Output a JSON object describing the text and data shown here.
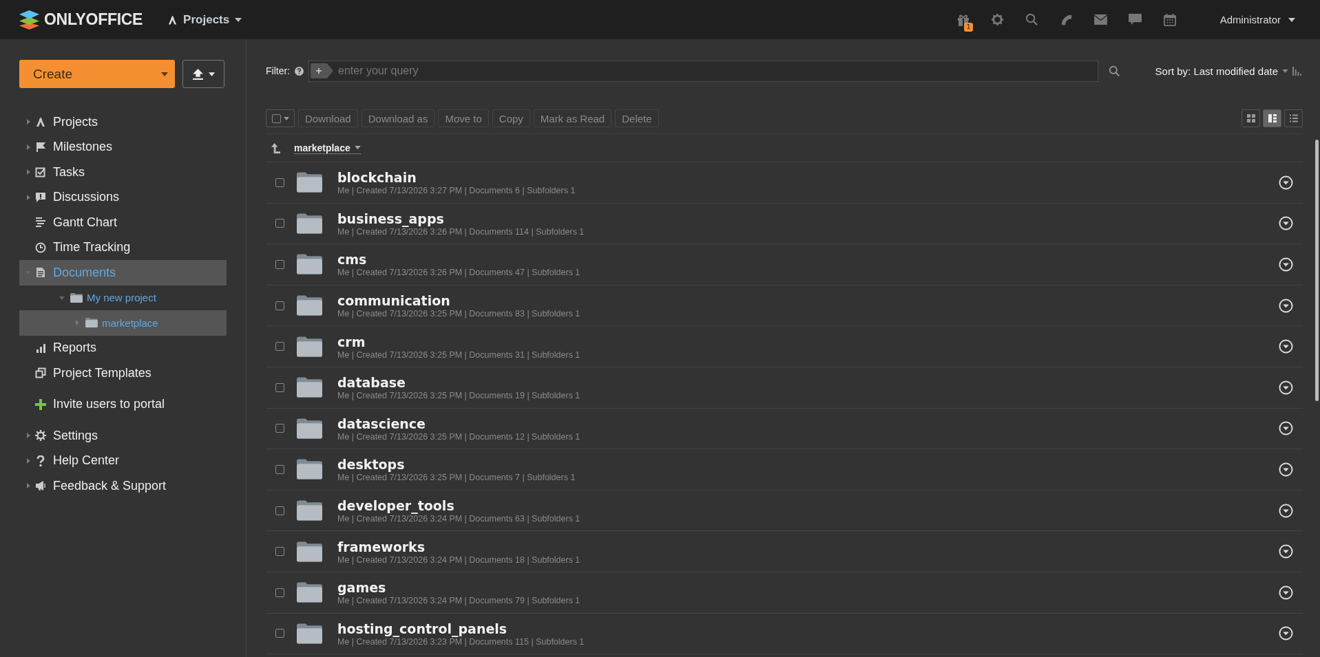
{
  "header": {
    "logo": "ONLYOFFICE",
    "module": "Projects",
    "gift_badge": "1",
    "user": "Administrator"
  },
  "sidebar": {
    "create_button": "Create",
    "nav": [
      {
        "label": "Projects",
        "expanded": false,
        "selected": false
      },
      {
        "label": "Milestones",
        "expanded": false,
        "selected": false
      },
      {
        "label": "Tasks",
        "expanded": false,
        "selected": false
      },
      {
        "label": "Discussions",
        "expanded": false,
        "selected": false
      },
      {
        "label": "Gantt Chart",
        "selected": false
      },
      {
        "label": "Time Tracking",
        "selected": false
      },
      {
        "label": "Documents",
        "expanded": true,
        "selected": true,
        "children": [
          {
            "label": "My new project",
            "expanded": true,
            "selected": false,
            "children": [
              {
                "label": "marketplace",
                "expanded": false,
                "selected": true
              }
            ]
          }
        ]
      },
      {
        "label": "Reports",
        "selected": false
      },
      {
        "label": "Project Templates",
        "selected": false
      }
    ],
    "invite": "Invite users to portal",
    "footer": [
      {
        "label": "Settings",
        "expanded": false
      },
      {
        "label": "Help Center",
        "expanded": false
      },
      {
        "label": "Feedback & Support",
        "expanded": false
      }
    ]
  },
  "filter": {
    "label": "Filter:",
    "placeholder": "enter your query",
    "sort": "Sort by: Last modified date"
  },
  "toolbar": {
    "actions": [
      {
        "label": "Download",
        "disabled": true
      },
      {
        "label": "Download as",
        "disabled": true
      },
      {
        "label": "Move to",
        "disabled": true
      },
      {
        "label": "Copy",
        "disabled": true
      },
      {
        "label": "Mark as Read",
        "disabled": true
      },
      {
        "label": "Delete",
        "disabled": true
      }
    ],
    "views": [
      {
        "selected": false
      },
      {
        "selected": true
      },
      {
        "selected": false
      }
    ]
  },
  "breadcrumb": "marketplace",
  "folders": [
    {
      "name": "blockchain",
      "meta": "Me | Created 7/13/2026 3:27 PM | Documents 6 | Subfolders 1",
      "checked": false
    },
    {
      "name": "business_apps",
      "meta": "Me | Created 7/13/2026 3:26 PM | Documents 114 | Subfolders 1",
      "checked": false
    },
    {
      "name": "cms",
      "meta": "Me | Created 7/13/2026 3:26 PM | Documents 47 | Subfolders 1",
      "checked": false
    },
    {
      "name": "communication",
      "meta": "Me | Created 7/13/2026 3:25 PM | Documents 83 | Subfolders 1",
      "checked": false
    },
    {
      "name": "crm",
      "meta": "Me | Created 7/13/2026 3:25 PM | Documents 31 | Subfolders 1",
      "checked": false
    },
    {
      "name": "database",
      "meta": "Me | Created 7/13/2026 3:25 PM | Documents 19 | Subfolders 1",
      "checked": false
    },
    {
      "name": "datascience",
      "meta": "Me | Created 7/13/2026 3:25 PM | Documents 12 | Subfolders 1",
      "checked": false
    },
    {
      "name": "desktops",
      "meta": "Me | Created 7/13/2026 3:25 PM | Documents 7 | Subfolders 1",
      "checked": false
    },
    {
      "name": "developer_tools",
      "meta": "Me | Created 7/13/2026 3:24 PM | Documents 63 | Subfolders 1",
      "checked": false
    },
    {
      "name": "frameworks",
      "meta": "Me | Created 7/13/2026 3:24 PM | Documents 18 | Subfolders 1",
      "checked": false
    },
    {
      "name": "games",
      "meta": "Me | Created 7/13/2026 3:24 PM | Documents 79 | Subfolders 1",
      "checked": false
    },
    {
      "name": "hosting_control_panels",
      "meta": "Me | Created 7/13/2026 3:23 PM | Documents 115 | Subfolders 1",
      "checked": false
    }
  ]
}
